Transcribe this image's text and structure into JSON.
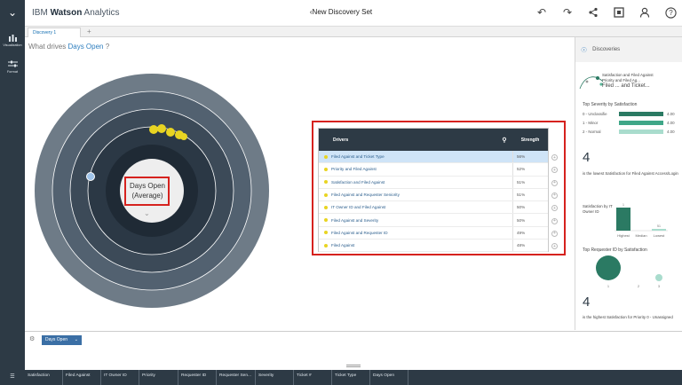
{
  "app": {
    "brand_ibm": "IBM",
    "brand_watson": "Watson",
    "brand_analytics": "Analytics",
    "title": "New Discovery Set"
  },
  "toolbar_icons": [
    "undo-icon",
    "redo-icon",
    "share-icon",
    "save-icon",
    "user-icon",
    "help-icon"
  ],
  "sidebar": {
    "items": [
      {
        "label": "Visualization",
        "icon": "bar-chart-icon"
      },
      {
        "label": "Format",
        "icon": "sliders-icon"
      }
    ]
  },
  "tabs": [
    {
      "label": "Discovery 1"
    }
  ],
  "tab_add": "+",
  "question": {
    "prefix": "What drives",
    "metric": "Days Open",
    "suffix": "?"
  },
  "center": {
    "line1": "Days Open",
    "line2": "(Average)"
  },
  "drivers": {
    "header_label": "Drivers",
    "strength_label": "Strength",
    "rows": [
      {
        "name": "Filed Against and Ticket Type",
        "strength": "56%"
      },
      {
        "name": "Priority and Filed Against",
        "strength": "52%"
      },
      {
        "name": "Satisfaction and Filed Against",
        "strength": "51%"
      },
      {
        "name": "Filed Against and Requester Seniority",
        "strength": "51%"
      },
      {
        "name": "IT Owner ID and Filed Against",
        "strength": "50%"
      },
      {
        "name": "Filed Against and Severity",
        "strength": "50%"
      },
      {
        "name": "Filed Against and Requester ID",
        "strength": "49%"
      },
      {
        "name": "Filed Against",
        "strength": "48%"
      }
    ]
  },
  "discoveries": {
    "title": "Discoveries",
    "mini_title1": "Satisfaction and Filed Against",
    "mini_title2": "Priority and Filed Ag...",
    "mini_title3": "Filed ... and Ticket...",
    "card1_title": "Top Severity by Satisfaction",
    "bars": [
      {
        "label": "0 - Unclassifie",
        "value": "4.00",
        "fill": 1.0,
        "color": "#2b7a63"
      },
      {
        "label": "1 - Minor",
        "value": "4.00",
        "fill": 1.0,
        "color": "#3fa788"
      },
      {
        "label": "2 - Normal",
        "value": "4.00",
        "fill": 1.0,
        "color": "#a9dccd"
      }
    ],
    "stat1_number": "4",
    "stat1_text": "is the lowest Satisfaction for Filed Against Access/Login",
    "card2_label": "Satisfaction by IT Owner ID",
    "card2_cols": [
      {
        "label": "Highest",
        "value": "1"
      },
      {
        "label": "Median",
        "value": ""
      },
      {
        "label": "Lowest",
        "value": "51"
      }
    ],
    "card3_title": "Top Requester ID by Satisfaction",
    "card3_ticks": [
      "1",
      "2",
      "3"
    ],
    "stat2_number": "4",
    "stat2_text": "is the highest Satisfaction for Priority 0 - Unassigned"
  },
  "bottom": {
    "column_pill": "Days Open"
  },
  "columns": [
    "Satisfaction",
    "Filed Against",
    "IT Owner ID",
    "Priority",
    "Requester ID",
    "Requester Sen...",
    "Severity",
    "Ticket #",
    "Ticket Type",
    "Days Open"
  ]
}
